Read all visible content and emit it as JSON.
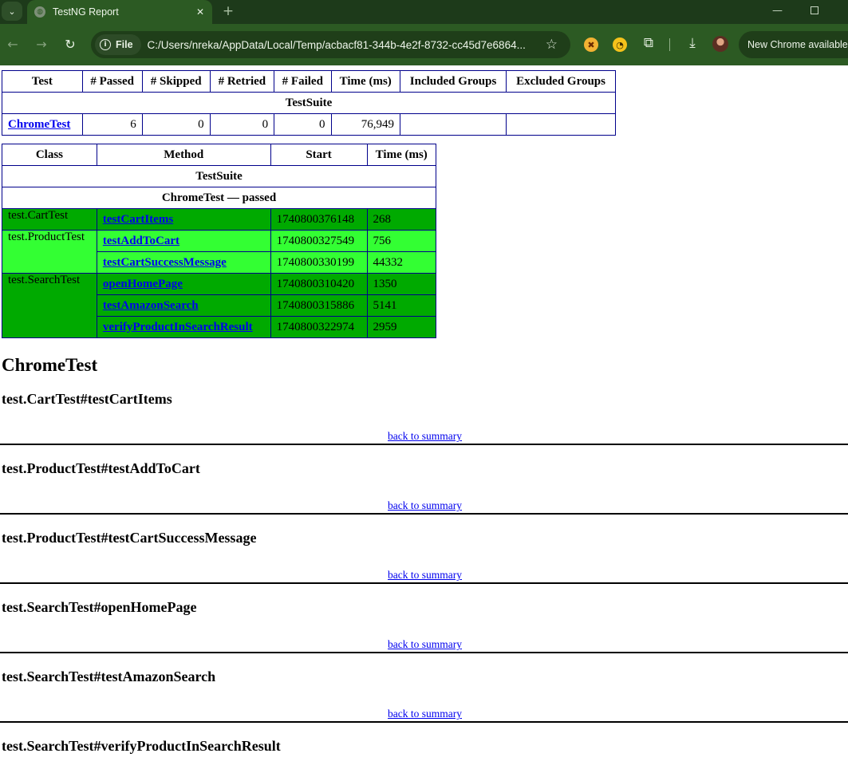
{
  "browser": {
    "tab_title": "TestNG Report",
    "url": "C:/Users/nreka/AppData/Local/Temp/acbacf81-344b-4e2f-8732-cc45d7e6864...",
    "site_chip": "File",
    "update_button": "New Chrome available",
    "icons": {
      "tab_search": "chevron-down-icon",
      "favicon": "globe-icon",
      "tab_close": "close-icon",
      "new_tab": "plus-icon",
      "back": "arrow-left-icon",
      "forward": "arrow-right-icon",
      "reload": "reload-icon",
      "site_info": "info-icon",
      "bookmark": "star-icon",
      "extensions": "puzzle-icon",
      "downloads": "download-icon"
    },
    "colors": {
      "tabstrip": "#1d3a1a",
      "toolbar": "#2c5a23"
    }
  },
  "summary": {
    "headers": [
      "Test",
      "# Passed",
      "# Skipped",
      "# Retried",
      "# Failed",
      "Time (ms)",
      "Included Groups",
      "Excluded Groups"
    ],
    "suite_name": "TestSuite",
    "rows": [
      {
        "test": "ChromeTest",
        "passed": "6",
        "skipped": "0",
        "retried": "0",
        "failed": "0",
        "time": "76,949",
        "included_groups": "",
        "excluded_groups": ""
      }
    ]
  },
  "methods": {
    "headers": [
      "Class",
      "Method",
      "Start",
      "Time (ms)"
    ],
    "suite_name": "TestSuite",
    "test_status": "ChromeTest — passed",
    "colors": {
      "pass_odd": "#00aa00",
      "pass_even": "#33ff33"
    },
    "groups": [
      {
        "class": "test.CartTest",
        "shade": "odd",
        "rows": [
          {
            "method": "testCartItems",
            "start": "1740800376148",
            "time": "268"
          }
        ]
      },
      {
        "class": "test.ProductTest",
        "shade": "even",
        "rows": [
          {
            "method": "testAddToCart",
            "start": "1740800327549",
            "time": "756"
          },
          {
            "method": "testCartSuccessMessage",
            "start": "1740800330199",
            "time": "44332"
          }
        ]
      },
      {
        "class": "test.SearchTest",
        "shade": "odd",
        "rows": [
          {
            "method": "openHomePage",
            "start": "1740800310420",
            "time": "1350"
          },
          {
            "method": "testAmazonSearch",
            "start": "1740800315886",
            "time": "5141"
          },
          {
            "method": "verifyProductInSearchResult",
            "start": "1740800322974",
            "time": "2959"
          }
        ]
      }
    ]
  },
  "details": {
    "test_heading": "ChromeTest",
    "back_link": "back to summary",
    "sections": [
      "test.CartTest#testCartItems",
      "test.ProductTest#testAddToCart",
      "test.ProductTest#testCartSuccessMessage",
      "test.SearchTest#openHomePage",
      "test.SearchTest#testAmazonSearch",
      "test.SearchTest#verifyProductInSearchResult"
    ]
  }
}
